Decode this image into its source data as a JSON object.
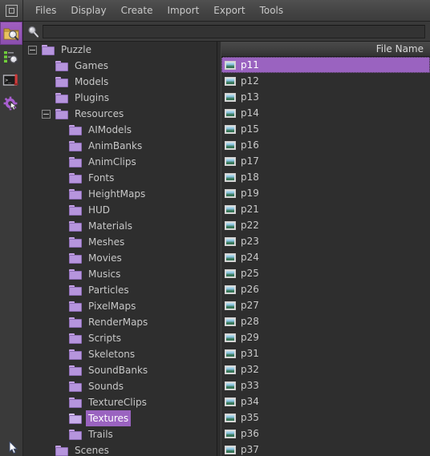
{
  "app": {
    "logo_icon": "square-in-square-icon",
    "accent": "#9a63c0",
    "background": "#2e2e2e"
  },
  "menubar": {
    "items": [
      {
        "label": "Files"
      },
      {
        "label": "Display"
      },
      {
        "label": "Create"
      },
      {
        "label": "Import"
      },
      {
        "label": "Export"
      },
      {
        "label": "Tools"
      }
    ]
  },
  "search": {
    "icon": "magnifier-icon",
    "value": "",
    "placeholder": ""
  },
  "toolstrip": {
    "items": [
      {
        "name": "asset-browser-tool",
        "icon": "folder-magnifier-icon",
        "active": true
      },
      {
        "name": "inspector-tool",
        "icon": "list-magnifier-icon",
        "active": false
      },
      {
        "name": "console-tool",
        "icon": "console-window-icon",
        "active": false
      },
      {
        "name": "settings-tool",
        "icon": "gear-cursor-icon",
        "active": false
      }
    ]
  },
  "tree": {
    "nodes": [
      {
        "label": "Puzzle",
        "depth": 0,
        "twisty": "minus",
        "open": false,
        "selected": false
      },
      {
        "label": "Games",
        "depth": 1,
        "twisty": "none",
        "open": false,
        "selected": false
      },
      {
        "label": "Models",
        "depth": 1,
        "twisty": "none",
        "open": false,
        "selected": false
      },
      {
        "label": "Plugins",
        "depth": 1,
        "twisty": "none",
        "open": false,
        "selected": false
      },
      {
        "label": "Resources",
        "depth": 1,
        "twisty": "minus",
        "open": false,
        "selected": false
      },
      {
        "label": "AIModels",
        "depth": 2,
        "twisty": "none",
        "open": false,
        "selected": false
      },
      {
        "label": "AnimBanks",
        "depth": 2,
        "twisty": "none",
        "open": false,
        "selected": false
      },
      {
        "label": "AnimClips",
        "depth": 2,
        "twisty": "none",
        "open": false,
        "selected": false
      },
      {
        "label": "Fonts",
        "depth": 2,
        "twisty": "none",
        "open": false,
        "selected": false
      },
      {
        "label": "HeightMaps",
        "depth": 2,
        "twisty": "none",
        "open": false,
        "selected": false
      },
      {
        "label": "HUD",
        "depth": 2,
        "twisty": "none",
        "open": false,
        "selected": false
      },
      {
        "label": "Materials",
        "depth": 2,
        "twisty": "none",
        "open": false,
        "selected": false
      },
      {
        "label": "Meshes",
        "depth": 2,
        "twisty": "none",
        "open": false,
        "selected": false
      },
      {
        "label": "Movies",
        "depth": 2,
        "twisty": "none",
        "open": false,
        "selected": false
      },
      {
        "label": "Musics",
        "depth": 2,
        "twisty": "none",
        "open": false,
        "selected": false
      },
      {
        "label": "Particles",
        "depth": 2,
        "twisty": "none",
        "open": false,
        "selected": false
      },
      {
        "label": "PixelMaps",
        "depth": 2,
        "twisty": "none",
        "open": false,
        "selected": false
      },
      {
        "label": "RenderMaps",
        "depth": 2,
        "twisty": "none",
        "open": false,
        "selected": false
      },
      {
        "label": "Scripts",
        "depth": 2,
        "twisty": "none",
        "open": false,
        "selected": false
      },
      {
        "label": "Skeletons",
        "depth": 2,
        "twisty": "none",
        "open": false,
        "selected": false
      },
      {
        "label": "SoundBanks",
        "depth": 2,
        "twisty": "none",
        "open": false,
        "selected": false
      },
      {
        "label": "Sounds",
        "depth": 2,
        "twisty": "none",
        "open": false,
        "selected": false
      },
      {
        "label": "TextureClips",
        "depth": 2,
        "twisty": "none",
        "open": false,
        "selected": false
      },
      {
        "label": "Textures",
        "depth": 2,
        "twisty": "none",
        "open": true,
        "selected": true
      },
      {
        "label": "Trails",
        "depth": 2,
        "twisty": "none",
        "open": false,
        "selected": false
      },
      {
        "label": "Scenes",
        "depth": 1,
        "twisty": "none",
        "open": false,
        "selected": false
      }
    ]
  },
  "filelist": {
    "column_header": "File Name",
    "rows": [
      {
        "name": "p11",
        "selected": true
      },
      {
        "name": "p12",
        "selected": false
      },
      {
        "name": "p13",
        "selected": false
      },
      {
        "name": "p14",
        "selected": false
      },
      {
        "name": "p15",
        "selected": false
      },
      {
        "name": "p16",
        "selected": false
      },
      {
        "name": "p17",
        "selected": false
      },
      {
        "name": "p18",
        "selected": false
      },
      {
        "name": "p19",
        "selected": false
      },
      {
        "name": "p21",
        "selected": false
      },
      {
        "name": "p22",
        "selected": false
      },
      {
        "name": "p23",
        "selected": false
      },
      {
        "name": "p24",
        "selected": false
      },
      {
        "name": "p25",
        "selected": false
      },
      {
        "name": "p26",
        "selected": false
      },
      {
        "name": "p27",
        "selected": false
      },
      {
        "name": "p28",
        "selected": false
      },
      {
        "name": "p29",
        "selected": false
      },
      {
        "name": "p31",
        "selected": false
      },
      {
        "name": "p32",
        "selected": false
      },
      {
        "name": "p33",
        "selected": false
      },
      {
        "name": "p34",
        "selected": false
      },
      {
        "name": "p35",
        "selected": false
      },
      {
        "name": "p36",
        "selected": false
      },
      {
        "name": "p37",
        "selected": false
      }
    ]
  }
}
